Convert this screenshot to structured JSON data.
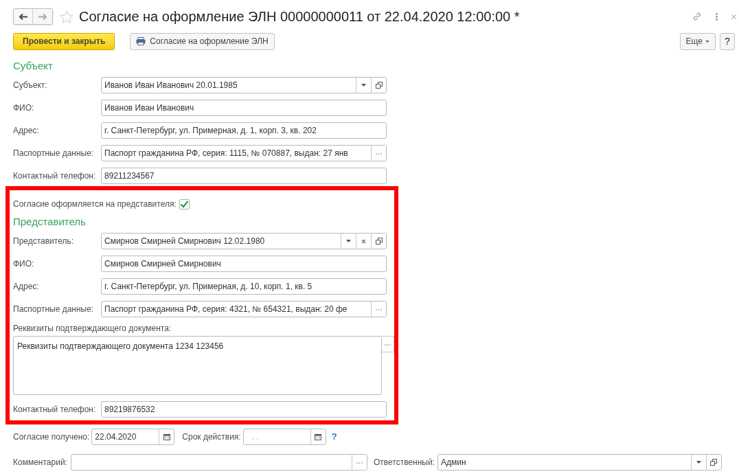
{
  "header": {
    "title": "Согласие на оформление ЭЛН 00000000011 от 22.04.2020 12:00:00 *",
    "favorite": false
  },
  "toolbar": {
    "primary": "Провести и закрыть",
    "print": "Согласие на оформление ЭЛН",
    "more": "Еще",
    "help": "?"
  },
  "subject": {
    "heading": "Субъект",
    "fields": [
      {
        "kind": "field",
        "label": "Субъект:",
        "value": "Иванов Иван Иванович 20.01.1985",
        "dropdown": true,
        "open": true
      },
      {
        "kind": "field",
        "label": "ФИО:",
        "value": "Иванов Иван Иванович"
      },
      {
        "kind": "field",
        "label": "Адрес:",
        "value": "г. Санкт-Петербург, ул. Примерная, д. 1, корп. 3, кв. 202"
      },
      {
        "kind": "field",
        "label": "Паспортные данные:",
        "value": "Паспорт гражданина РФ, серия: 1115, № 070887, выдан: 27 янв",
        "more": true
      },
      {
        "kind": "field",
        "label": "Контактный телефон:",
        "value": "89211234567"
      }
    ]
  },
  "representative": {
    "checkbox": {
      "label": "Согласие оформляется на представителя:",
      "checked": true
    },
    "heading": "Представитель",
    "fields": [
      {
        "kind": "field",
        "label": "Представитель:",
        "value": "Смирнов Смирней Смирнович 12.02.1980",
        "dropdown": true,
        "clear": true,
        "open": true
      },
      {
        "kind": "field",
        "label": "ФИО:",
        "value": "Смирнов Смирней Смирнович"
      },
      {
        "kind": "field",
        "label": "Адрес:",
        "value": "г. Санкт-Петербург, ул. Примерная, д. 10, корп. 1, кв. 5"
      },
      {
        "kind": "field",
        "label": "Паспортные данные:",
        "value": "Паспорт гражданина РФ, серия: 4321, № 654321, выдан: 20 фе",
        "more": true
      },
      {
        "kind": "textarea",
        "label": "Реквизиты подтверждающего документа:",
        "value": "Реквизиты подтверждающего документа 1234 123456",
        "more": true
      },
      {
        "kind": "field",
        "label": "Контактный телефон:",
        "value": "89219876532"
      }
    ]
  },
  "dates": [
    {
      "label": "Согласие получено:",
      "value": "22.04.2020",
      "calendar": true
    },
    {
      "label": "Срок действия:",
      "placeholder": ". .",
      "calendar": true
    }
  ],
  "dates_help": "?",
  "comment": {
    "label": "Комментарий:",
    "more": true
  },
  "responsible": {
    "label": "Ответственный:",
    "value": "Админ",
    "dropdown": true,
    "open": true
  }
}
